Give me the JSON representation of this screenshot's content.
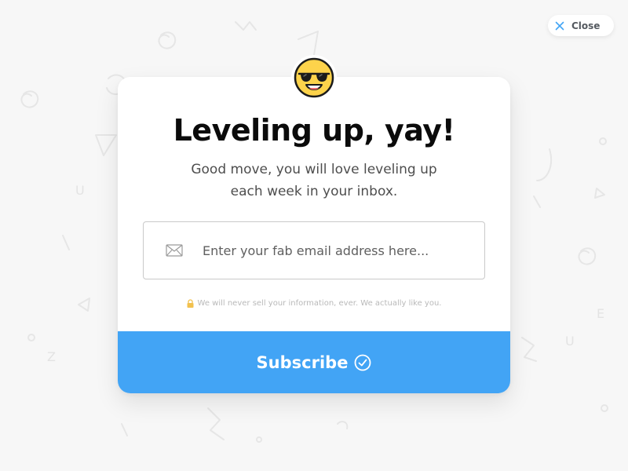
{
  "close_button": {
    "label": "Close",
    "icon": "close-icon"
  },
  "modal": {
    "avatar_icon": "sunglasses-emoji-icon",
    "title": "Leveling up, yay!",
    "subtitle_line1": "Good move, you will love leveling up",
    "subtitle_line2": "each week in your inbox.",
    "email_field": {
      "icon": "mail-icon",
      "placeholder": "Enter your fab email address here...",
      "value": ""
    },
    "privacy_note": "We will never sell your information, ever. We actually like you.",
    "privacy_icon": "lock-icon",
    "subscribe_button": {
      "label": "Subscribe",
      "icon": "check-circle-icon"
    }
  },
  "colors": {
    "background": "#f7f7f7",
    "accent": "#42a4f5",
    "title": "#0b0b0b",
    "emoji_yellow": "#fdd34b",
    "lock": "#f2c14e"
  }
}
